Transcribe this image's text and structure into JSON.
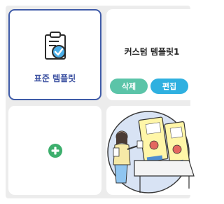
{
  "templates": {
    "standard": {
      "label": "표준 템플릿",
      "icon": "clipboard-check-icon",
      "selected": true
    },
    "custom": {
      "title": "커스텀 템플릿1",
      "delete_label": "삭제",
      "edit_label": "편집"
    },
    "add": {
      "icon": "plus-circle-icon"
    },
    "image_template": {
      "illustration": "woman-voting-illustration"
    }
  },
  "colors": {
    "selected_border": "#3f5ba8",
    "delete_button": "#5bc4a8",
    "edit_button": "#2fb0e0",
    "add_icon": "#3daf6d"
  }
}
